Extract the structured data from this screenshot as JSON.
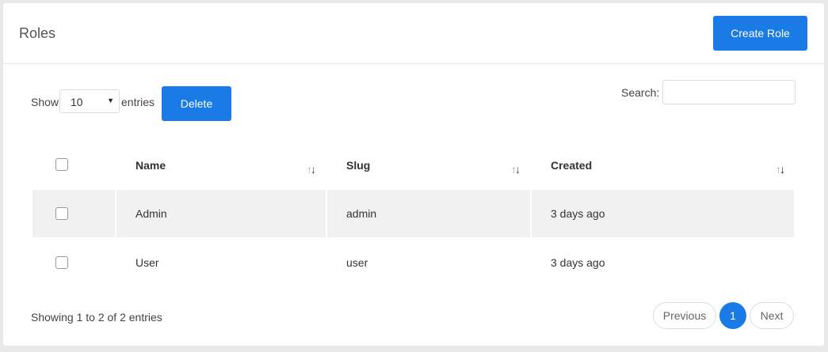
{
  "header": {
    "title": "Roles",
    "create_label": "Create Role"
  },
  "controls": {
    "show_label": "Show",
    "entries_value": "10",
    "entries_label": "entries",
    "delete_label": "Delete",
    "search_label": "Search:",
    "search_value": ""
  },
  "table": {
    "columns": [
      "Name",
      "Slug",
      "Created"
    ],
    "rows": [
      {
        "name": "Admin",
        "slug": "admin",
        "created": "3 days ago"
      },
      {
        "name": "User",
        "slug": "user",
        "created": "3 days ago"
      }
    ]
  },
  "footer": {
    "info": "Showing 1 to 2 of 2 entries",
    "previous_label": "Previous",
    "current_page": "1",
    "next_label": "Next"
  },
  "colors": {
    "accent": "#1a7be6",
    "stripe": "#f1f1f1",
    "background": "#e9e9e9"
  },
  "icons": {
    "sort": "sort-arrows-icon",
    "select": "caret-down-icon"
  }
}
